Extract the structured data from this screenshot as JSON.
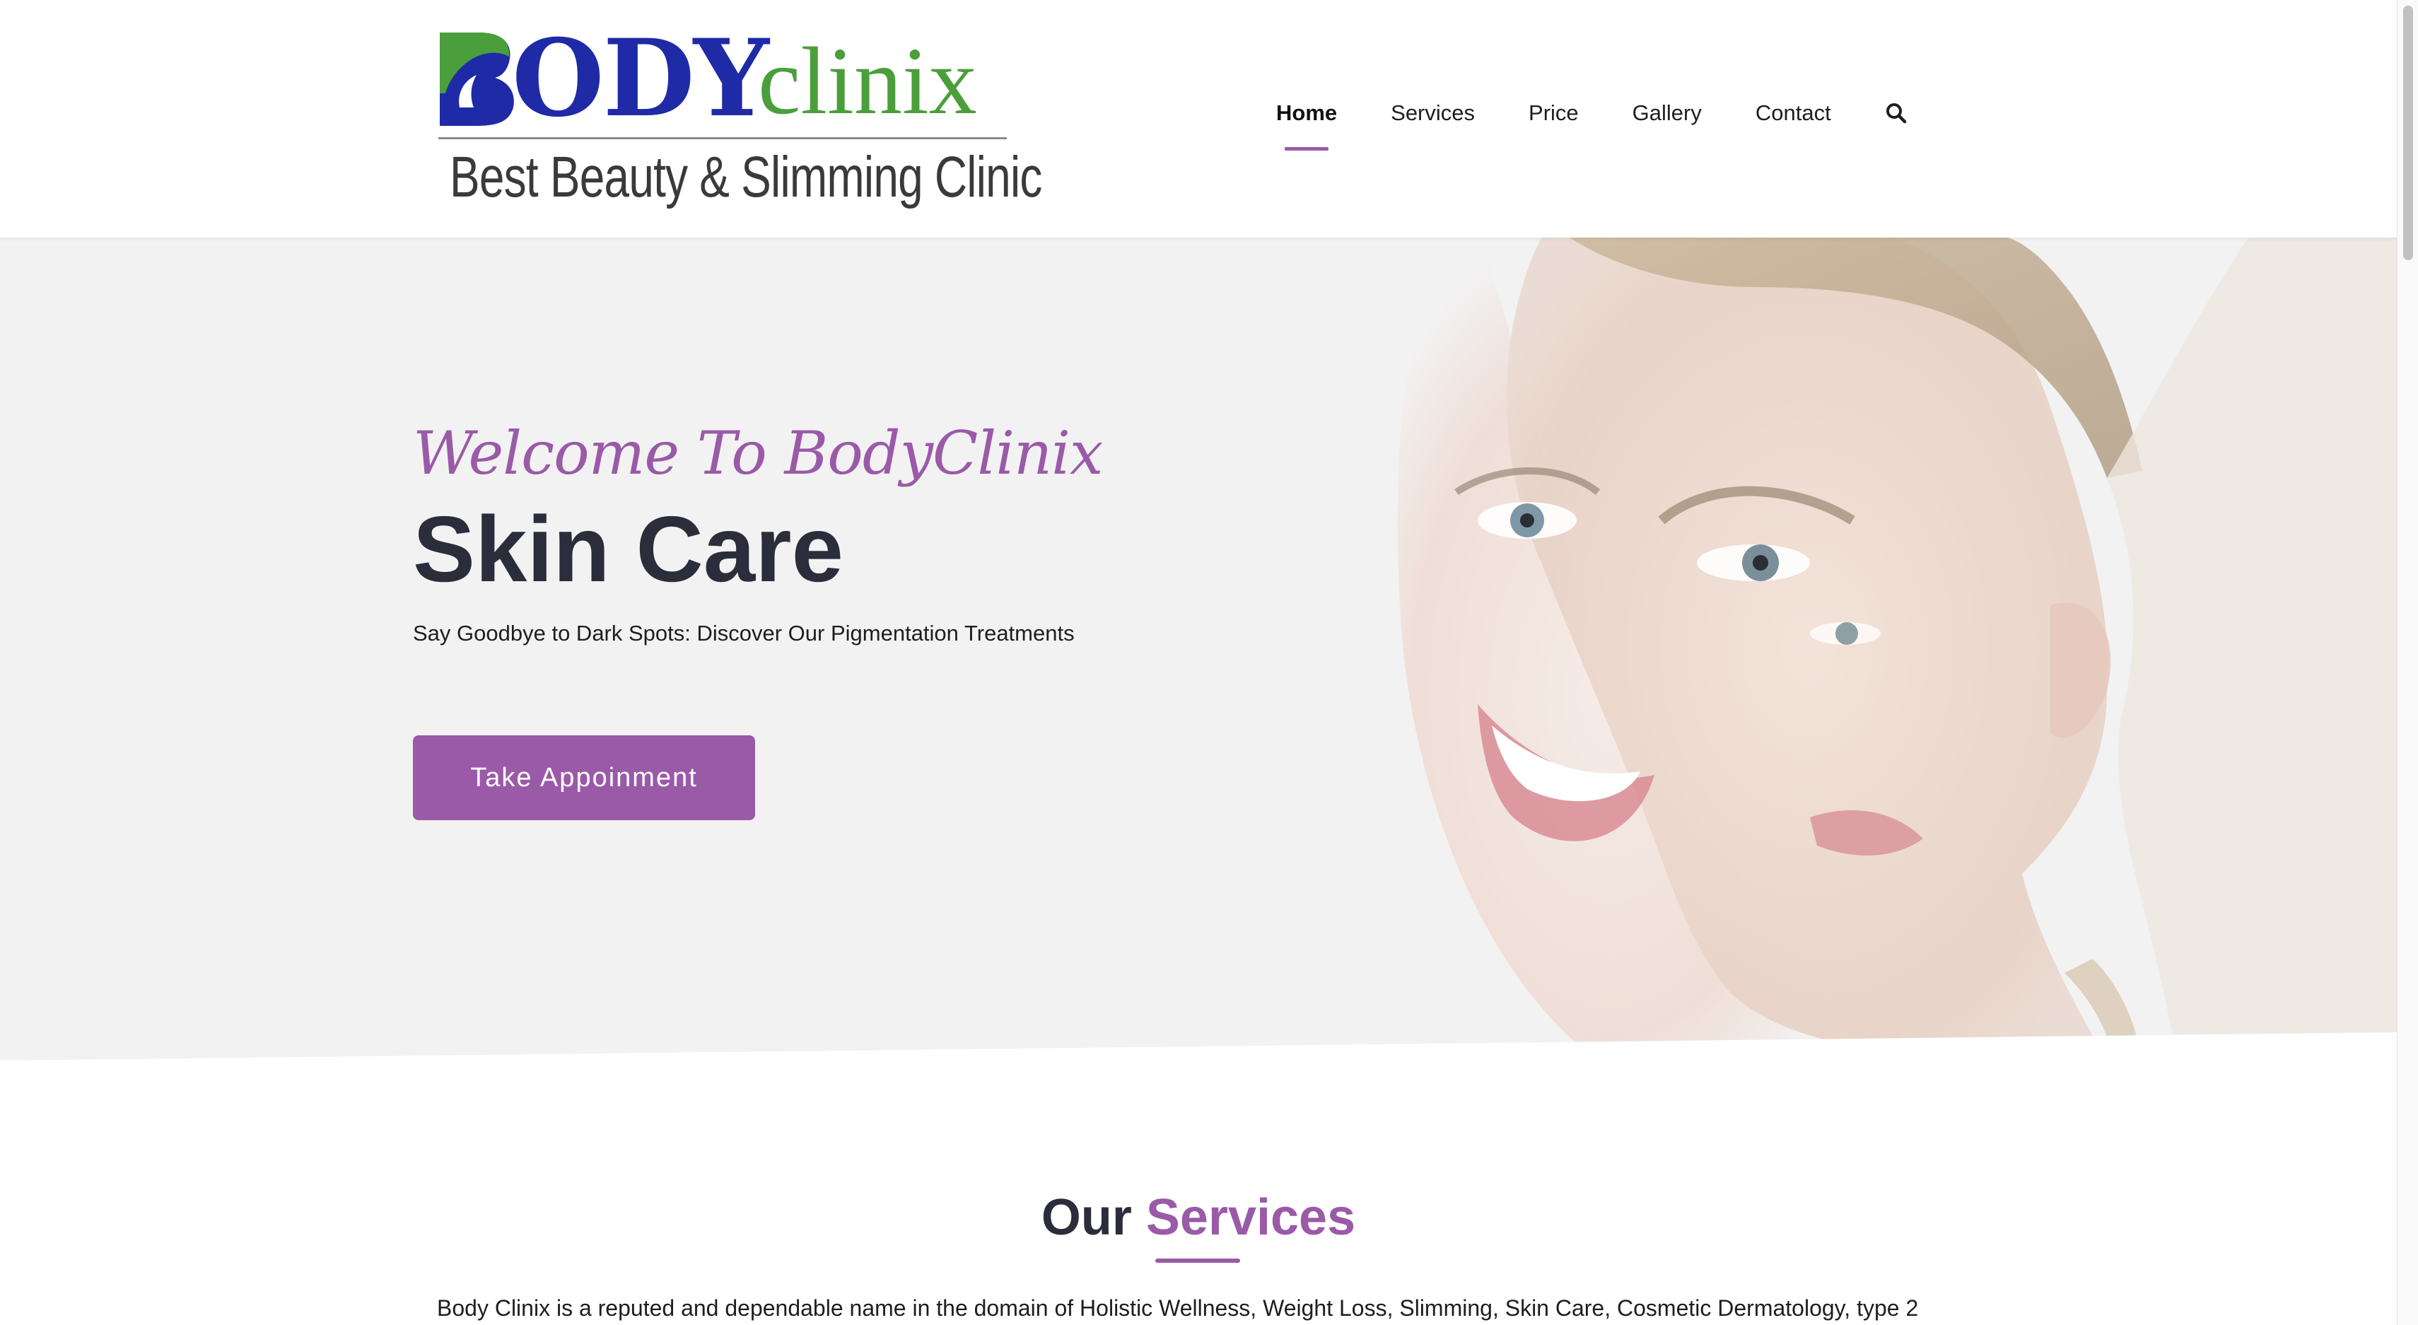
{
  "brand": {
    "logo_body": "ODY",
    "logo_clinix": "clinix",
    "tagline": "Best Beauty & Slimming Clinic",
    "colors": {
      "blue": "#1f2aa6",
      "green": "#4b9e3c",
      "accent": "#9a5aa8"
    }
  },
  "nav": {
    "items": [
      {
        "label": "Home",
        "active": true
      },
      {
        "label": "Services"
      },
      {
        "label": "Price"
      },
      {
        "label": "Gallery"
      },
      {
        "label": "Contact"
      }
    ],
    "search_icon": "search-icon"
  },
  "hero": {
    "welcome": "Welcome To BodyClinix",
    "title": "Skin Care",
    "subtitle": "Say Goodbye to Dark Spots: Discover Our Pigmentation Treatments",
    "cta_label": "Take Appoinment"
  },
  "services": {
    "heading_dark": "Our",
    "heading_accent": "Services",
    "description": "Body Clinix is a reputed and dependable name in the domain of Holistic Wellness, Weight Loss, Slimming, Skin Care, Cosmetic Dermatology, type 2"
  }
}
